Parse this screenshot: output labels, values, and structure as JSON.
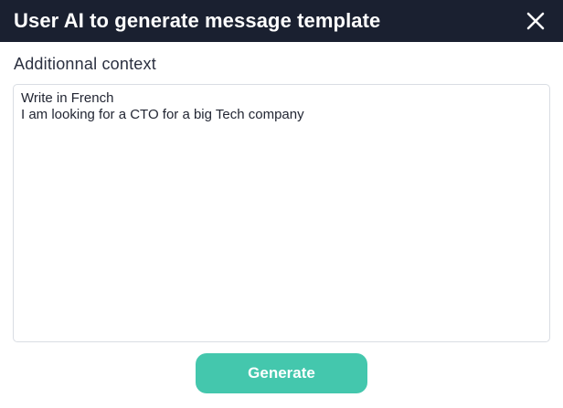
{
  "dialog": {
    "title": "User AI to generate message template",
    "close_icon": "close-icon"
  },
  "form": {
    "context_label": "Additionnal context",
    "context_value": "Write in French\nI am looking for a CTO for a big Tech company",
    "generate_label": "Generate"
  },
  "colors": {
    "header_bg": "#1a2030",
    "accent": "#44c7ad"
  }
}
